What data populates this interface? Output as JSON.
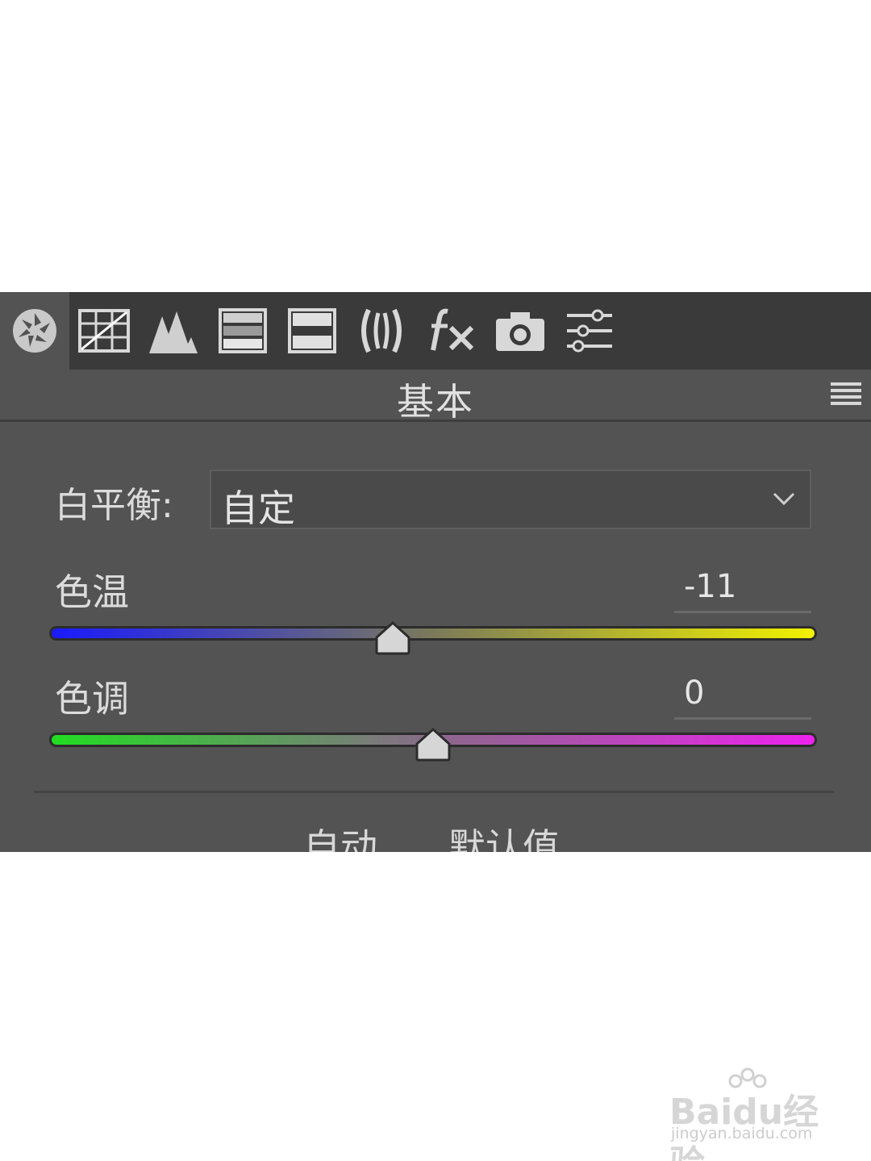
{
  "toolbar": {
    "icons": [
      "aperture-icon",
      "tone-curve-icon",
      "detail-icon",
      "hsl-icon",
      "split-toning-icon",
      "lens-icon",
      "fx-icon",
      "camera-icon",
      "presets-icon"
    ],
    "active_index": 0
  },
  "section": {
    "title": "基本",
    "menu_icon": "panel-menu-icon"
  },
  "white_balance": {
    "label": "白平衡:",
    "value": "自定"
  },
  "sliders": {
    "temperature": {
      "label": "色温",
      "value": "-11",
      "position": 0.447
    },
    "tint": {
      "label": "色调",
      "value": "0",
      "position": 0.5
    }
  },
  "actions": {
    "auto": "自动",
    "default": "默认值"
  },
  "watermark": {
    "logo": "Baidu经验",
    "url": "jingyan.baidu.com"
  },
  "colors": {
    "panel": "#535353",
    "toolbar": "#3a3a3a",
    "temp_cool": "#1a1aff",
    "temp_warm": "#f2f200",
    "tint_green": "#22dd22",
    "tint_magenta": "#ee22ee"
  }
}
